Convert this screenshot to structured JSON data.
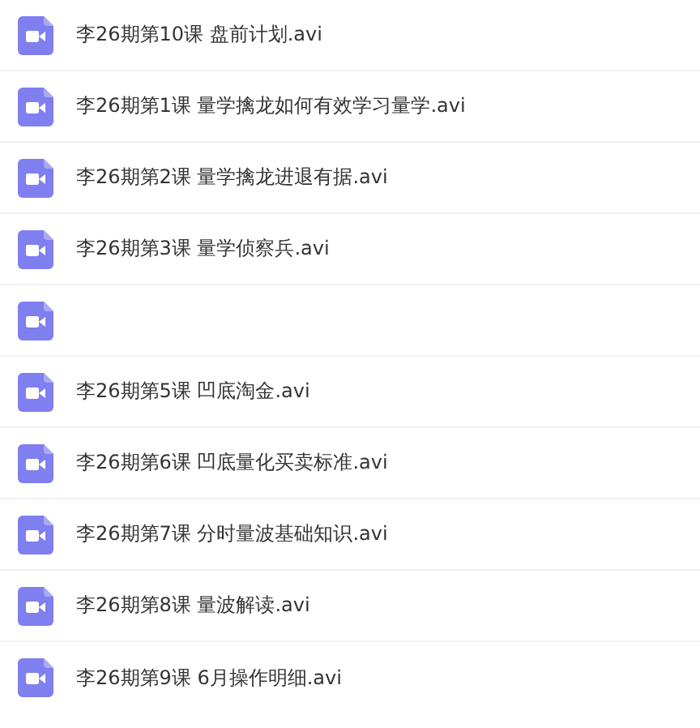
{
  "files": [
    {
      "kind": "video",
      "name": "李26期第10课 盘前计划.avi"
    },
    {
      "kind": "video",
      "name": "李26期第1课 量学擒龙如何有效学习量学.avi"
    },
    {
      "kind": "video",
      "name": "李26期第2课 量学擒龙进退有据.avi"
    },
    {
      "kind": "video",
      "name": "李26期第3课 量学侦察兵.avi"
    },
    {
      "kind": "video"
    },
    {
      "kind": "video",
      "name": "李26期第5课 凹底淘金.avi"
    },
    {
      "kind": "video",
      "name": "李26期第6课 凹底量化买卖标准.avi"
    },
    {
      "kind": "video",
      "name": "李26期第7课 分时量波基础知识.avi"
    },
    {
      "kind": "video",
      "name": "李26期第8课 量波解读.avi"
    },
    {
      "kind": "video",
      "name": "李26期第9课 6月操作明细.avi"
    }
  ]
}
